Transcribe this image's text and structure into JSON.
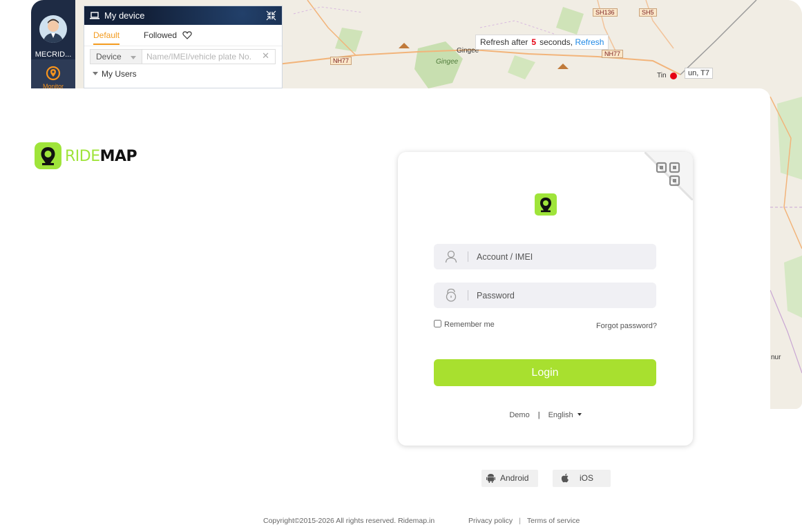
{
  "background_app": {
    "user_name": "MECRID...",
    "monitor_label": "Monitor",
    "panel_title": "My device",
    "tabs": [
      "Default",
      "Followed"
    ],
    "search_type": "Device",
    "search_placeholder": "Name/IMEI/vehicle plate No.",
    "tree_root": "My Users",
    "refresh": {
      "prefix": "Refresh after",
      "count": "5",
      "suffix": "seconds,",
      "link": "Refresh"
    },
    "map_labels": {
      "sh136": "SH136",
      "sh5": "SH5",
      "nh77a": "NH77",
      "nh77b": "NH77",
      "gingee": "Gingee",
      "gingee_lake": "Gingee",
      "tindivanam": "Tin",
      "tindivanam2": "un, T7",
      "nur": "nur"
    }
  },
  "brand": {
    "ride": "RIDE",
    "map": "MAP"
  },
  "login": {
    "account_placeholder": "Account / IMEI",
    "password_placeholder": "Password",
    "remember_label": "Remember me",
    "forgot_label": "Forgot password?",
    "login_button": "Login",
    "demo_link": "Demo",
    "divider": "|",
    "language": "English"
  },
  "apps": {
    "android": "Android",
    "ios": "iOS"
  },
  "footer": {
    "copyright": "Copyright©2015-2026 All rights reserved. Ridemap.in",
    "privacy": "Privacy policy",
    "separator": "|",
    "terms": "Terms of service"
  },
  "colors": {
    "accent_green": "#a8e02f",
    "brand_green": "#9fe43a",
    "orange_tab": "#f39a1d",
    "refresh_count": "#e60012",
    "refresh_link": "#1e88e5",
    "navy": "#13213a"
  }
}
